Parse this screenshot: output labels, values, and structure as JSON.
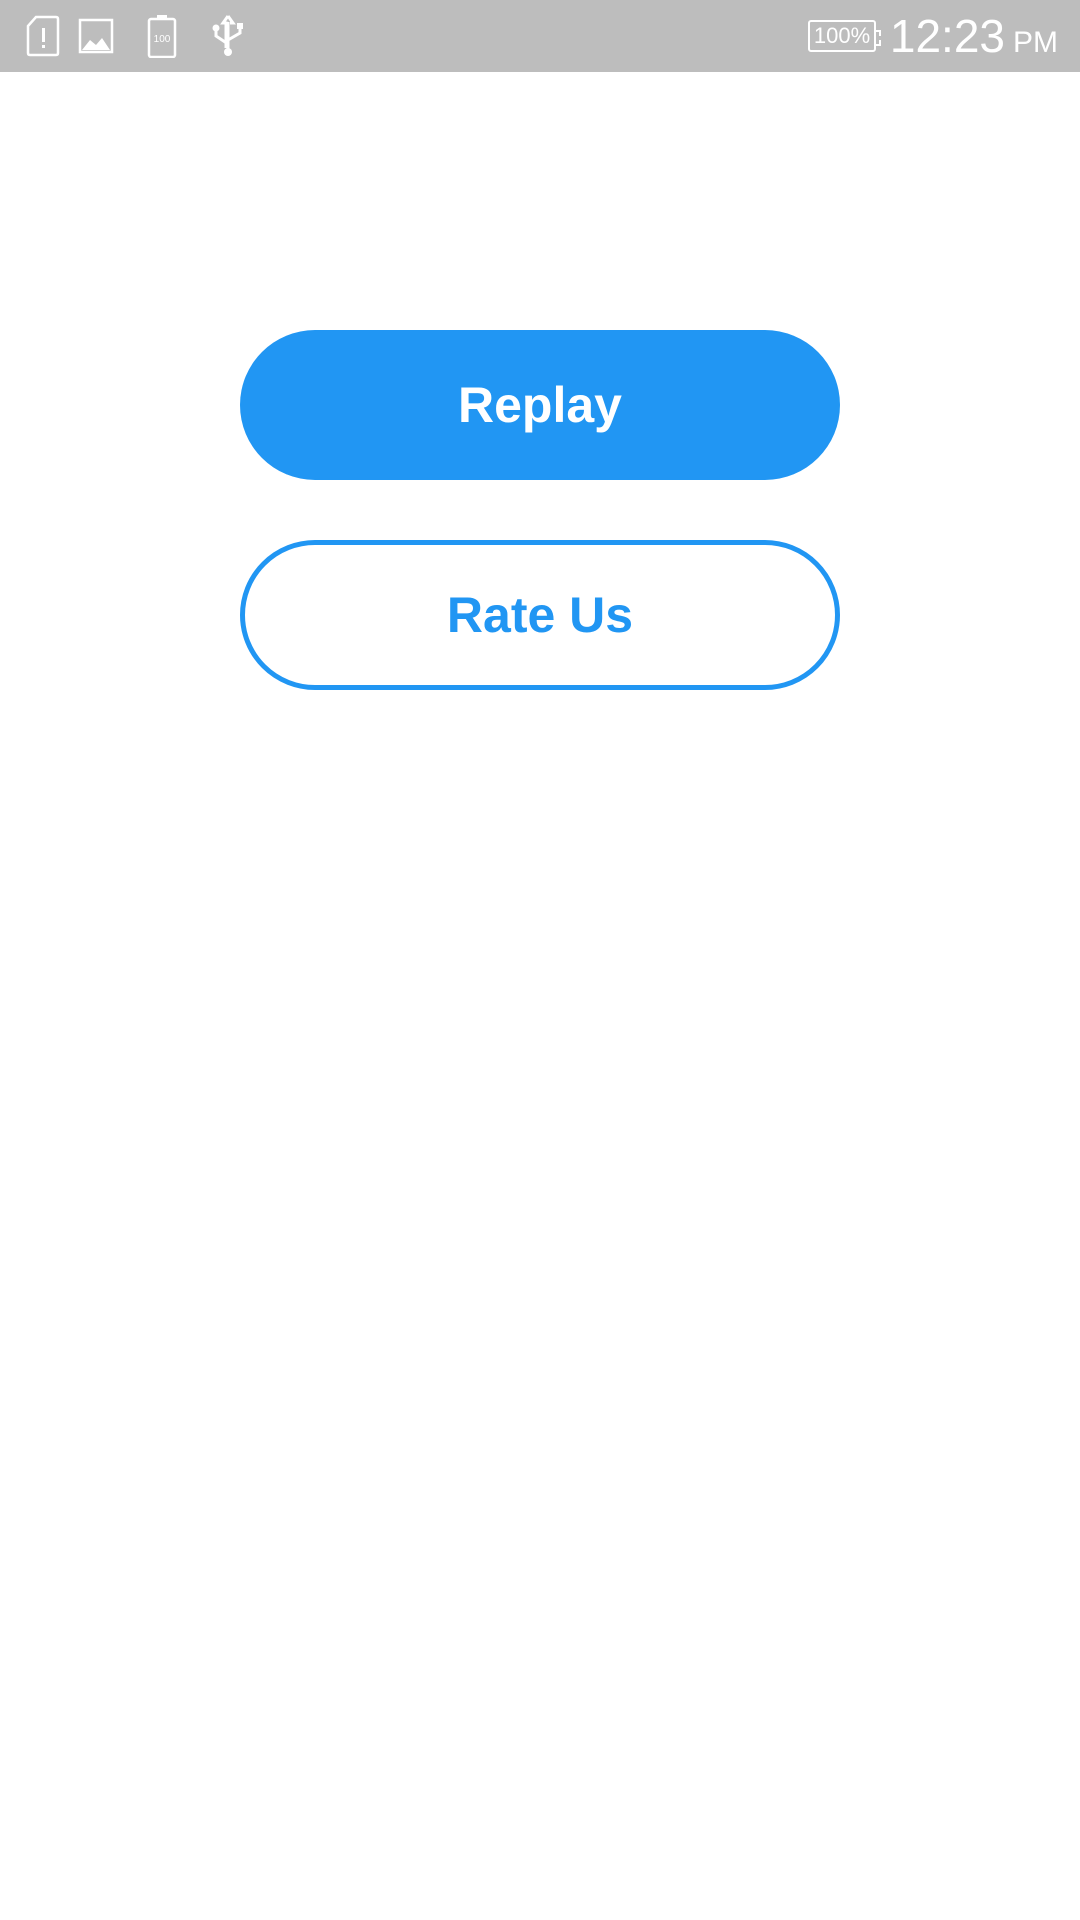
{
  "status_bar": {
    "icons": [
      "sim-alert-icon",
      "image-icon",
      "battery-saver-icon",
      "usb-icon"
    ],
    "battery_percent": "100%",
    "battery_small_label": "100",
    "time": "12:23",
    "ampm": "PM"
  },
  "actions": {
    "replay_label": "Replay",
    "rate_label": "Rate Us"
  },
  "colors": {
    "accent": "#2196f3",
    "status_bar": "#bdbdbd",
    "background": "#ffffff"
  }
}
